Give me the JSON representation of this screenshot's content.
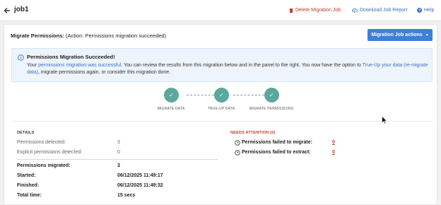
{
  "header": {
    "title": "job1",
    "delete_label": "Delete Migration Job",
    "download_label": "Download Job Report",
    "help_label": "Help"
  },
  "summary": {
    "label": "Migrate Permissions:",
    "action_text": "(Action: Permissions migration succeeded)",
    "actions_button": "Migration Job actions"
  },
  "alert": {
    "title": "Permissions Migration Succeeded!",
    "text_1": "Your ",
    "link_1": "permissions migration was successful",
    "text_2": ". You can review the results from this migration below and in the panel to the right. You now have the option to ",
    "link_2": "True-Up your data (re-migrate data)",
    "text_3": ", migrate permissions again, or consider this migration done."
  },
  "steps": [
    {
      "label": "MIGRATE DATA",
      "icon": "check-icon"
    },
    {
      "label": "TRUE-UP DATA",
      "icon": "check-icon"
    },
    {
      "label": "MIGRATE PERMISSIONS",
      "icon": "check-icon"
    }
  ],
  "details": {
    "heading": "DETAILS",
    "rows": [
      {
        "label": "Permissions detected:",
        "value": "3"
      },
      {
        "label": "Explicit permissions detected:",
        "value": "0"
      },
      {
        "label": "Permissions migrated:",
        "value": "3"
      },
      {
        "label": "Started:",
        "value": "06/12/2025 11:49:17"
      },
      {
        "label": "Finished:",
        "value": "06/12/2025 11:49:32"
      },
      {
        "label": "Total time:",
        "value": "15 secs"
      }
    ]
  },
  "needs_attention": {
    "heading": "NEEDS ATTENTION (0)",
    "rows": [
      {
        "label": "Permissions failed to migrate:",
        "value": "0"
      },
      {
        "label": "Permissions failed to extract:",
        "value": "0"
      }
    ]
  },
  "colors": {
    "primary": "#3f7fd9",
    "success_step": "#5aa89a",
    "danger": "#c0392b",
    "alert_bg": "#eef4fc"
  }
}
